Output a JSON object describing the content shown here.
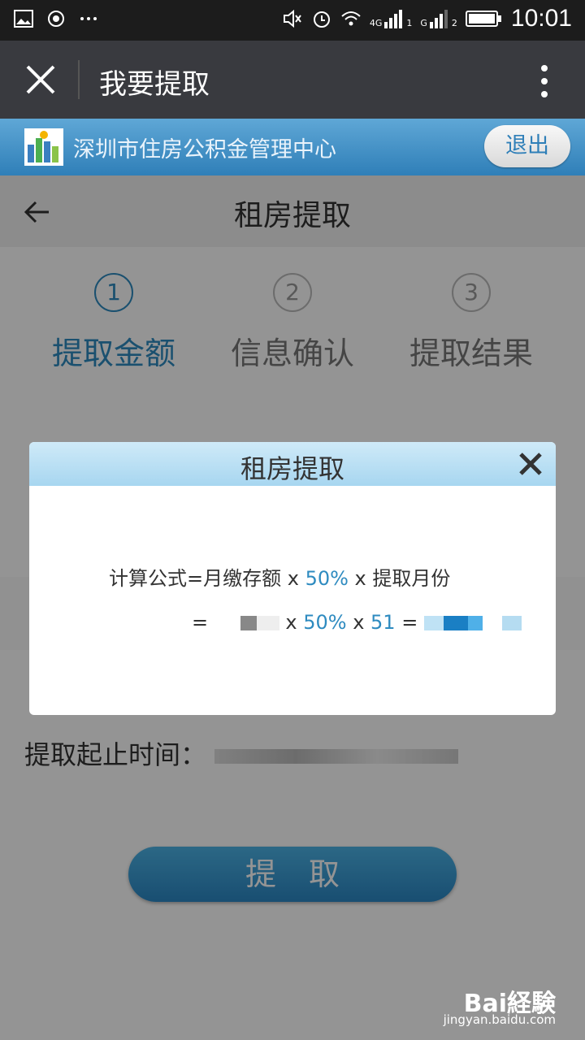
{
  "status_bar": {
    "time": "10:01",
    "signal_a": "4G",
    "signal_b": "G",
    "sim1": "1",
    "sim2": "2"
  },
  "navbar": {
    "title": "我要提取"
  },
  "banner": {
    "org_name": "深圳市住房公积金管理中心",
    "exit_label": "退出"
  },
  "subheader": {
    "title": "租房提取"
  },
  "steps": [
    {
      "num": "1",
      "label": "提取金额",
      "active": true
    },
    {
      "num": "2",
      "label": "信息确认",
      "active": false
    },
    {
      "num": "3",
      "label": "提取结果",
      "active": false
    }
  ],
  "form": {
    "time_label": "提取起止时间："
  },
  "submit_label": "提取",
  "modal": {
    "title": "租房提取",
    "formula_prefix": "计算公式=月缴存额",
    "formula_x1": " x ",
    "formula_pct": "50%",
    "formula_x2": " x ",
    "formula_suffix": "提取月份",
    "line2_eq": "=",
    "line2_x1": " x ",
    "line2_pct": "50%",
    "line2_x2": " x ",
    "line2_months": "51",
    "line2_eq2": " = "
  },
  "watermark": {
    "brand": "Bai経験",
    "url": "jingyan.baidu.com"
  },
  "colors": {
    "accent": "#2e8bc0",
    "navbar": "#393a3f",
    "statusbar": "#1c1c1c"
  }
}
